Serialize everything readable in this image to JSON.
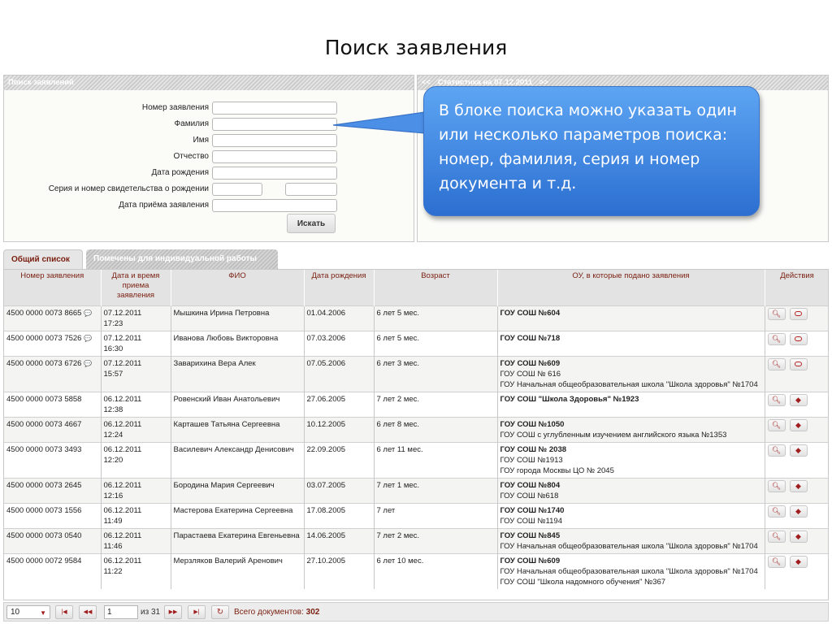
{
  "slide_title": "Поиск заявления",
  "search_panel": {
    "title": "Поиск заявлений",
    "fields": [
      {
        "label": "Номер заявления",
        "value": ""
      },
      {
        "label": "Фамилия",
        "value": ""
      },
      {
        "label": "Имя",
        "value": ""
      },
      {
        "label": "Отчество",
        "value": ""
      },
      {
        "label": "Дата рождения",
        "value": ""
      },
      {
        "label": "Серия и номер свидетельства о рождении",
        "value": "",
        "value2": ""
      },
      {
        "label": "Дата приёма заявления",
        "value": ""
      }
    ],
    "search_button": "Искать"
  },
  "stats_panel": {
    "prev": "<<",
    "title": "Статистика на 07.12.2011",
    "next": ">>"
  },
  "callout": {
    "text": "В блоке поиска можно указать один или несколько параметров поиска: номер, фамилия, серия и номер документа и т.д."
  },
  "tabs": [
    {
      "label": "Общий список",
      "active": true
    },
    {
      "label": "Помечены для индивидуальной работы",
      "active": false
    }
  ],
  "table": {
    "headers": [
      "Номер заявления",
      "Дата и время приема заявления",
      "ФИО",
      "Дата рождения",
      "Возраст",
      "ОУ, в которые подано заявления",
      "Действия"
    ],
    "rows": [
      {
        "num": "4500 0000 0073 8665",
        "comment": true,
        "date": "07.12.2011",
        "time": "17:23",
        "fio": "Мышкина Ирина Петровна",
        "dob": "01.04.2006",
        "age": "6 лет 5 мес.",
        "ou": [
          "ГОУ СОШ №604"
        ],
        "action2": "pill"
      },
      {
        "num": "4500 0000 0073 7526",
        "comment": true,
        "date": "07.12.2011",
        "time": "16:30",
        "fio": "Иванова Любовь Викторовна",
        "dob": "07.03.2006",
        "age": "6 лет 5 мес.",
        "ou": [
          "ГОУ СОШ №718"
        ],
        "action2": "pill"
      },
      {
        "num": "4500 0000 0073 6726",
        "comment": true,
        "date": "07.12.2011",
        "time": "15:57",
        "fio": "Заварихина Вера Алек",
        "dob": "07.05.2006",
        "age": "6 лет 3 мес.",
        "ou": [
          "ГОУ СОШ №609",
          "ГОУ СОШ № 616",
          "ГОУ Начальная общеобразовательная школа \"Школа здоровья\" №1704"
        ],
        "action2": "pill"
      },
      {
        "num": "4500 0000 0073 5858",
        "comment": false,
        "date": "06.12.2011",
        "time": "12:38",
        "fio": "Ровенский Иван Анатольевич",
        "dob": "27.06.2005",
        "age": "7 лет 2 мес.",
        "ou": [
          "ГОУ СОШ \"Школа Здоровья\" №1923"
        ],
        "action2": "tag"
      },
      {
        "num": "4500 0000 0073 4667",
        "comment": false,
        "date": "06.12.2011",
        "time": "12:24",
        "fio": "Карташев Татьяна Сергеевна",
        "dob": "10.12.2005",
        "age": "6 лет 8 мес.",
        "ou": [
          "ГОУ СОШ №1050",
          "ГОУ СОШ с углубленным изучением английского языка №1353"
        ],
        "action2": "tag"
      },
      {
        "num": "4500 0000 0073 3493",
        "comment": false,
        "date": "06.12.2011",
        "time": "12:20",
        "fio": "Василевич Александр Денисович",
        "dob": "22.09.2005",
        "age": "6 лет 11 мес.",
        "ou": [
          "ГОУ СОШ № 2038",
          "ГОУ СОШ №1913",
          "ГОУ города Москвы ЦО № 2045"
        ],
        "action2": "tag"
      },
      {
        "num": "4500 0000 0073 2645",
        "comment": false,
        "date": "06.12.2011",
        "time": "12:16",
        "fio": "Бородина Мария Сергеевич",
        "dob": "03.07.2005",
        "age": "7 лет 1 мес.",
        "ou": [
          "ГОУ СОШ №804",
          "ГОУ СОШ №618"
        ],
        "action2": "tag"
      },
      {
        "num": "4500 0000 0073 1556",
        "comment": false,
        "date": "06.12.2011",
        "time": "11:49",
        "fio": "Мастерова Екатерина Сергеевна",
        "dob": "17.08.2005",
        "age": "7 лет",
        "ou": [
          "ГОУ СОШ №1740",
          "ГОУ СОШ №1194"
        ],
        "action2": "tag"
      },
      {
        "num": "4500 0000 0073 0540",
        "comment": false,
        "date": "06.12.2011",
        "time": "11:46",
        "fio": "Парастаева Екатерина Евгеньевна",
        "dob": "14.06.2005",
        "age": "7 лет 2 мес.",
        "ou": [
          "ГОУ СОШ №845",
          "ГОУ Начальная общеобразовательная школа \"Школа здоровья\" №1704"
        ],
        "action2": "tag"
      },
      {
        "num": "4500 0000 0072 9584",
        "comment": false,
        "date": "06.12.2011",
        "time": "11:22",
        "fio": "Мерзляков Валерий Аренович",
        "dob": "27.10.2005",
        "age": "6 лет 10 мес.",
        "ou": [
          "ГОУ СОШ №609",
          "ГОУ Начальная общеобразовательная школа \"Школа здоровья\" №1704",
          "ГОУ СОШ \"Школа надомного обучения\" №367"
        ],
        "action2": "tag"
      }
    ]
  },
  "pager": {
    "page_size": "10",
    "current_page": "1",
    "of_label": "из 31",
    "total_label": "Всего документов:",
    "total_value": "302"
  },
  "colors": {
    "header_text": "#7a1f10",
    "callout_top": "#5da5f3",
    "callout_bottom": "#2c6fd1"
  }
}
